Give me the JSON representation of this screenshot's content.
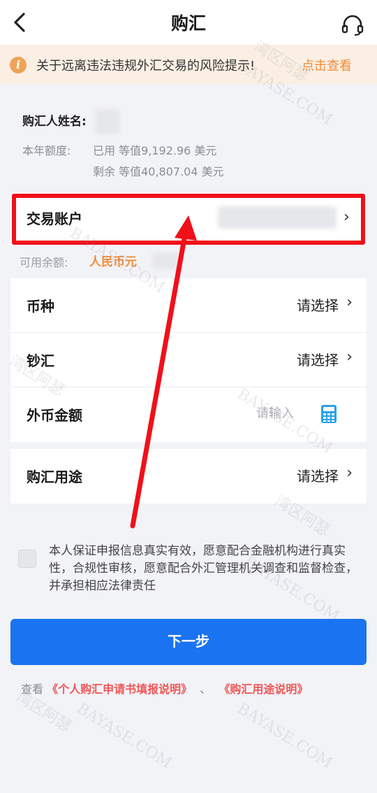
{
  "header": {
    "title": "购汇"
  },
  "notice": {
    "icon": "i",
    "text": "关于远离违法违规外汇交易的风险提示!",
    "link": "点击查看"
  },
  "buyer": {
    "label": "购汇人姓名:"
  },
  "quota": {
    "label": "本年额度:",
    "used": "已用 等值9,192.96 美元",
    "remaining": "剩余 等值40,807.04 美元"
  },
  "account": {
    "label": "交易账户"
  },
  "balance": {
    "label": "可用余额:",
    "currency": "人民币元"
  },
  "form": {
    "currency_label": "币种",
    "currency_value": "请选择",
    "cash_label": "钞汇",
    "cash_value": "请选择",
    "amount_label": "外币金额",
    "amount_placeholder": "请输入",
    "purpose_label": "购汇用途",
    "purpose_value": "请选择"
  },
  "agreement": {
    "text": "本人保证申报信息真实有效，愿意配合金融机构进行真实性，合规性审核，愿意配合外汇管理机关调查和监督检查，并承担相应法律责任"
  },
  "next_button": "下一步",
  "footer": {
    "prefix": "查看",
    "link1": "《个人购汇申请书填报说明》",
    "separator": "、",
    "link2": "《购汇用途说明》"
  },
  "watermark": {
    "cn": "湾区阿瑟",
    "en": "BAYASE.COM"
  },
  "colors": {
    "accent": "#1a73f0",
    "warning": "#f08c3a",
    "highlight": "#f0101a",
    "link": "#f05656"
  }
}
